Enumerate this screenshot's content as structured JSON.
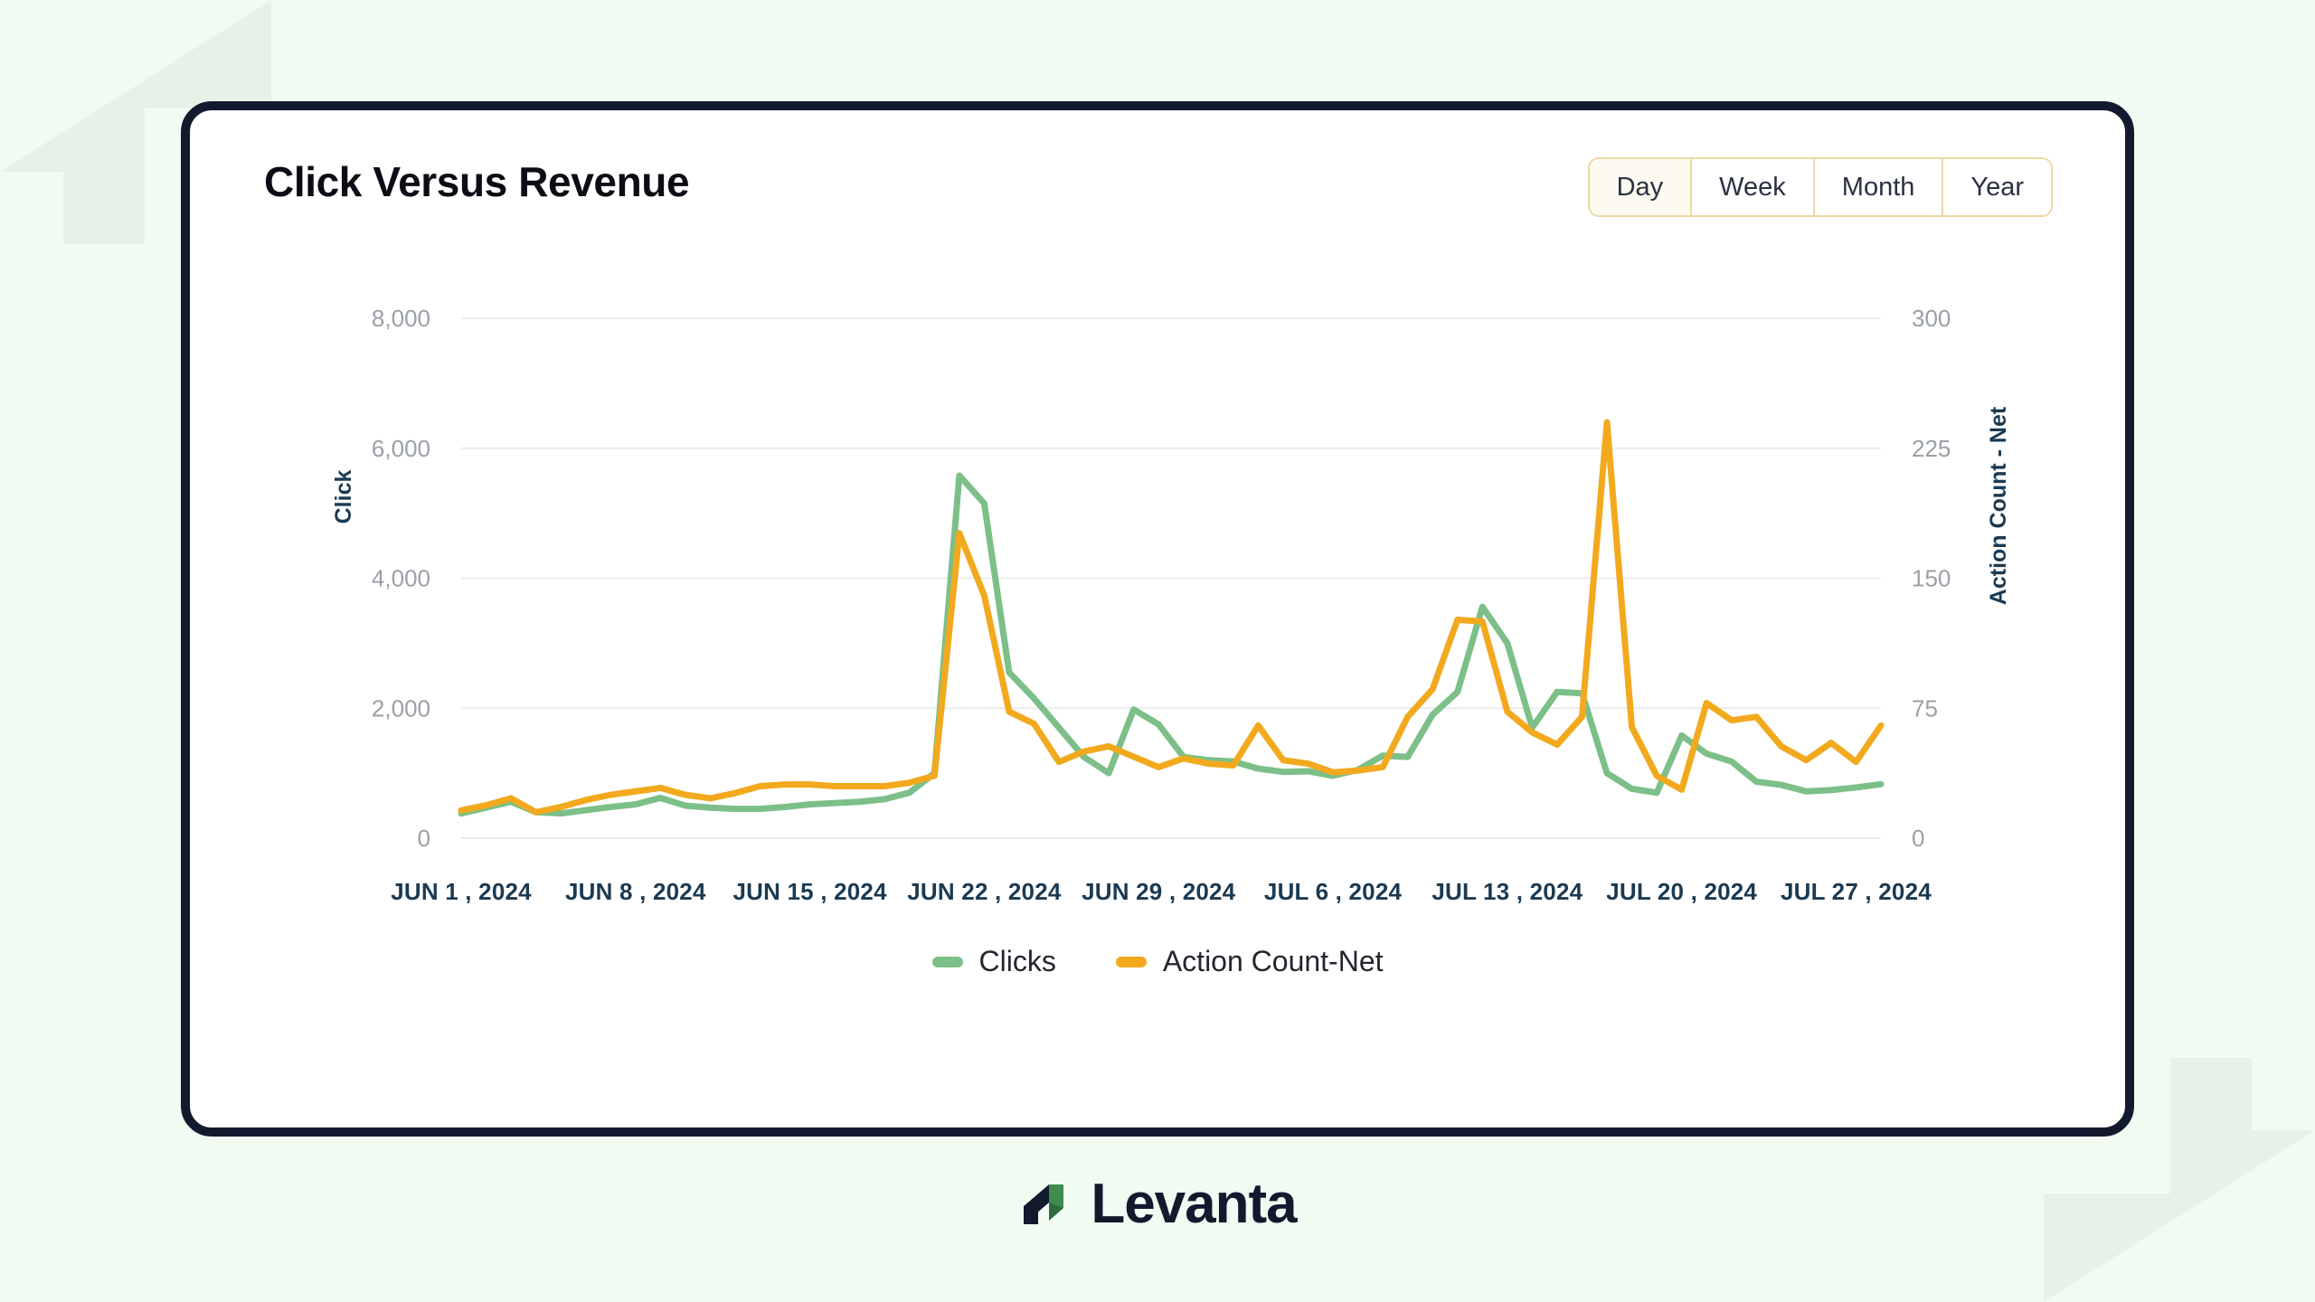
{
  "page": {
    "background_color": "#F1FBF2",
    "card_border_color": "#121A2E"
  },
  "header": {
    "title": "Click Versus Revenue"
  },
  "range_selector": {
    "selected": "Day",
    "options": [
      {
        "label": "Day",
        "selected": true
      },
      {
        "label": "Week",
        "selected": false
      },
      {
        "label": "Month",
        "selected": false
      },
      {
        "label": "Year",
        "selected": false
      }
    ]
  },
  "legend": {
    "items": [
      {
        "label": "Clicks",
        "color": "#7CBF88"
      },
      {
        "label": "Action Count-Net",
        "color": "#F2A91E"
      }
    ]
  },
  "brand": {
    "name": "Levanta",
    "mark_dark": "#121A2E",
    "mark_green": "#3E8C4E"
  },
  "chart_data": {
    "type": "line",
    "title": "Click Versus Revenue",
    "xlabel": "",
    "ylabel": "Click",
    "y2label": "Action Count - Net",
    "ylim": [
      0,
      8000
    ],
    "y2lim": [
      0,
      300
    ],
    "yticks": [
      "0",
      "2,000",
      "4,000",
      "6,000",
      "8,000"
    ],
    "ytick_values": [
      0,
      2000,
      4000,
      6000,
      8000
    ],
    "y2ticks": [
      "0",
      "75",
      "150",
      "225",
      "300"
    ],
    "y2tick_values": [
      0,
      75,
      150,
      225,
      300
    ],
    "grid": true,
    "legend_position": "bottom-center",
    "xtick_labels": [
      "JUN 1 , 2024",
      "JUN 8 , 2024",
      "JUN 15 , 2024",
      "JUN 22 , 2024",
      "JUN 29 , 2024",
      "JUL 6 , 2024",
      "JUL 13 , 2024",
      "JUL 20 , 2024",
      "JUL 27 , 2024"
    ],
    "xtick_indices": [
      0,
      7,
      14,
      21,
      28,
      35,
      42,
      49,
      56
    ],
    "x": [
      "JUN 1, 2024",
      "JUN 2, 2024",
      "JUN 3, 2024",
      "JUN 4, 2024",
      "JUN 5, 2024",
      "JUN 6, 2024",
      "JUN 7, 2024",
      "JUN 8, 2024",
      "JUN 9, 2024",
      "JUN 10, 2024",
      "JUN 11, 2024",
      "JUN 12, 2024",
      "JUN 13, 2024",
      "JUN 14, 2024",
      "JUN 15, 2024",
      "JUN 16, 2024",
      "JUN 17, 2024",
      "JUN 18, 2024",
      "JUN 19, 2024",
      "JUN 20, 2024",
      "JUN 21, 2024",
      "JUN 22, 2024",
      "JUN 23, 2024",
      "JUN 24, 2024",
      "JUN 25, 2024",
      "JUN 26, 2024",
      "JUN 27, 2024",
      "JUN 28, 2024",
      "JUN 29, 2024",
      "JUN 30, 2024",
      "JUL 1, 2024",
      "JUL 2, 2024",
      "JUL 3, 2024",
      "JUL 4, 2024",
      "JUL 5, 2024",
      "JUL 6, 2024",
      "JUL 7, 2024",
      "JUL 8, 2024",
      "JUL 9, 2024",
      "JUL 10, 2024",
      "JUL 11, 2024",
      "JUL 12, 2024",
      "JUL 13, 2024",
      "JUL 14, 2024",
      "JUL 15, 2024",
      "JUL 16, 2024",
      "JUL 17, 2024",
      "JUL 18, 2024",
      "JUL 19, 2024",
      "JUL 20, 2024",
      "JUL 21, 2024",
      "JUL 22, 2024",
      "JUL 23, 2024",
      "JUL 24, 2024",
      "JUL 25, 2024",
      "JUL 26, 2024",
      "JUL 27, 2024",
      "JUL 28, 2024"
    ],
    "series": [
      {
        "name": "Clicks",
        "color": "#7CBF88",
        "axis": "left",
        "values": [
          380,
          470,
          560,
          400,
          380,
          430,
          480,
          520,
          620,
          500,
          470,
          450,
          450,
          480,
          520,
          540,
          560,
          600,
          700,
          1000,
          5580,
          5150,
          2550,
          2150,
          1700,
          1250,
          1000,
          1980,
          1750,
          1250,
          1200,
          1180,
          1070,
          1020,
          1030,
          960,
          1050,
          1270,
          1250,
          1900,
          2250,
          3560,
          3000,
          1700,
          2250,
          2230,
          1000,
          760,
          700,
          1580,
          1300,
          1180,
          870,
          820,
          720,
          740,
          780,
          830
        ]
      },
      {
        "name": "Action Count-Net",
        "color": "#F2A91E",
        "axis": "right",
        "values": [
          16,
          19,
          23,
          15,
          18,
          22,
          25,
          27,
          29,
          25,
          23,
          26,
          30,
          31,
          31,
          30,
          30,
          30,
          32,
          36,
          176,
          140,
          73,
          66,
          44,
          50,
          53,
          47,
          41,
          46,
          43,
          42,
          65,
          45,
          43,
          38,
          39,
          41,
          70,
          86,
          126,
          125,
          73,
          61,
          54,
          70,
          240,
          64,
          36,
          28,
          78,
          68,
          70,
          53,
          45,
          55,
          44,
          65
        ]
      }
    ]
  }
}
